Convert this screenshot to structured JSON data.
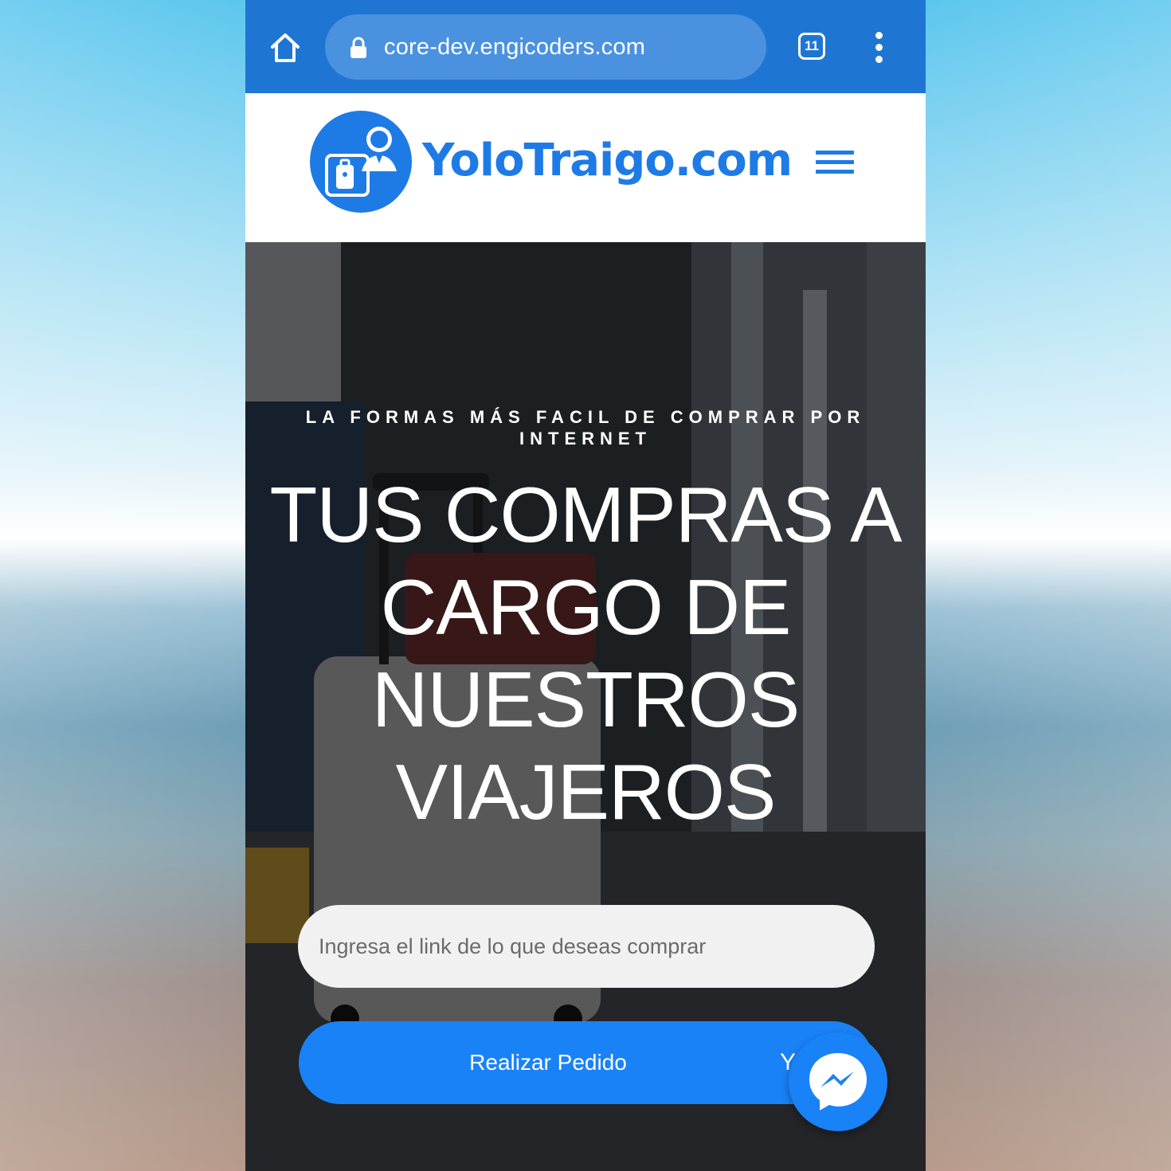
{
  "browser": {
    "url": "core-dev.engicoders.com",
    "tab_count": "11",
    "accent": "#1f76d2"
  },
  "site": {
    "logo_text": "YoloTraigo.com",
    "brand_color": "#1e7be6"
  },
  "hero": {
    "tagline": "LA FORMAS MÁS FACIL DE COMPRAR POR INTERNET",
    "headline_lines": [
      "TUS COMPRAS A",
      "CARGO DE",
      "NUESTROS",
      "VIAJEROS"
    ],
    "link_input": {
      "value": "",
      "placeholder": "Ingresa el link de lo que deseas comprar"
    },
    "order_button_label": "Realizar Pedido",
    "order_button_glyph": "Y"
  },
  "icons": {
    "home": "home-icon",
    "lock": "lock-icon",
    "tabs": "tab-switcher-icon",
    "overflow": "more-vert-icon",
    "menu": "hamburger-menu-icon",
    "messenger": "messenger-icon"
  }
}
